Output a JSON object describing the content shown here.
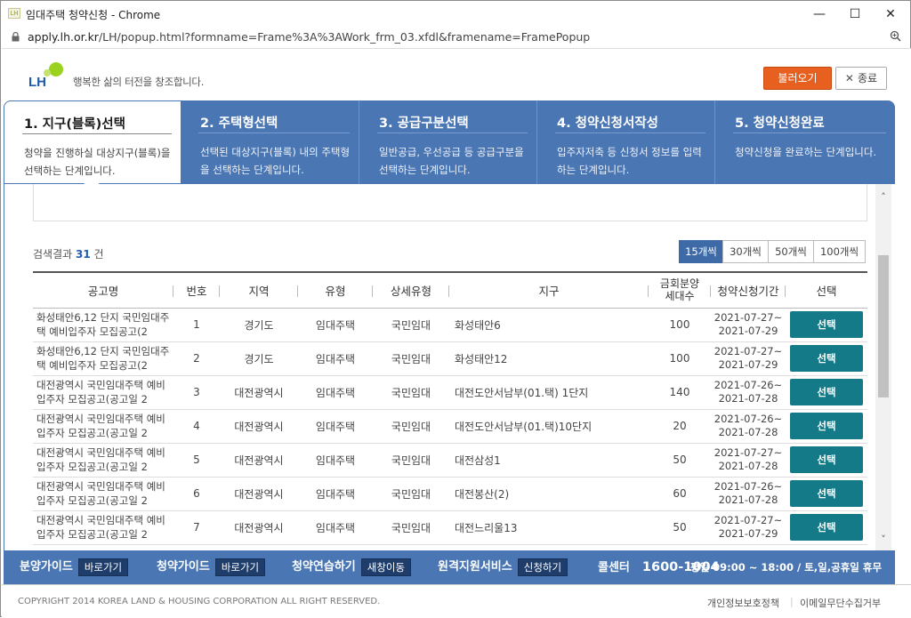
{
  "window": {
    "title": "임대주택 청약신청 - Chrome",
    "favicon": "LH",
    "minimize": "—",
    "maximize": "☐",
    "close": "✕"
  },
  "address": {
    "url_host": "apply.lh.or.kr",
    "url_path": "/LH/popup.html?formname=Frame%3A%3AWork_frm_03.xfdl&framename=FramePopup"
  },
  "header": {
    "logo_text": "LH",
    "slogan": "행복한 삶의 터전을 창조합니다.",
    "load_label": "불러오기",
    "close_label": "종료",
    "close_x": "✕"
  },
  "steps": [
    {
      "title": "1. 지구(블록)선택",
      "desc": "청약을 진행하실 대상지구(블록)을 선택하는 단계입니다."
    },
    {
      "title": "2. 주택형선택",
      "desc": "선택된 대상지구(블록) 내의 주택형을 선택하는 단계입니다."
    },
    {
      "title": "3. 공급구분선택",
      "desc": "일반공급, 우선공급 등 공급구분을 선택하는 단계입니다."
    },
    {
      "title": "4. 청약신청서작성",
      "desc": "입주자저축 등 신청서 정보를 입력하는 단계입니다."
    },
    {
      "title": "5. 청약신청완료",
      "desc": "청약신청을 완료하는 단계입니다."
    }
  ],
  "results": {
    "label": "검색결과",
    "count": "31",
    "unit": "건"
  },
  "pager": [
    "15개씩",
    "30개씩",
    "50개씩",
    "100개씩"
  ],
  "table": {
    "headers": {
      "name": "공고명",
      "no": "번호",
      "region": "지역",
      "type": "유형",
      "subtype": "상세유형",
      "district": "지구",
      "units1": "금회분양",
      "units2": "세대수",
      "period": "청약신청기간",
      "select": "선택"
    },
    "rows": [
      {
        "name": "화성태안6,12 단지 국민임대주택 예비입주자 모집공고(2",
        "no": "1",
        "region": "경기도",
        "type": "임대주택",
        "subtype": "국민임대",
        "district": "화성태안6",
        "units": "100",
        "p1": "2021-07-27~",
        "p2": "2021-07-29",
        "btn": "선택"
      },
      {
        "name": "화성태안6,12 단지 국민임대주택 예비입주자 모집공고(2",
        "no": "2",
        "region": "경기도",
        "type": "임대주택",
        "subtype": "국민임대",
        "district": "화성태안12",
        "units": "100",
        "p1": "2021-07-27~",
        "p2": "2021-07-29",
        "btn": "선택"
      },
      {
        "name": "대전광역시 국민임대주택 예비입주자 모집공고(공고일 2",
        "no": "3",
        "region": "대전광역시",
        "type": "임대주택",
        "subtype": "국민임대",
        "district": "대전도안서남부(01.택) 1단지",
        "units": "140",
        "p1": "2021-07-26~",
        "p2": "2021-07-28",
        "btn": "선택"
      },
      {
        "name": "대전광역시 국민임대주택 예비입주자 모집공고(공고일 2",
        "no": "4",
        "region": "대전광역시",
        "type": "임대주택",
        "subtype": "국민임대",
        "district": "대전도안서남부(01.택)10단지",
        "units": "20",
        "p1": "2021-07-26~",
        "p2": "2021-07-28",
        "btn": "선택"
      },
      {
        "name": "대전광역시 국민임대주택 예비입주자 모집공고(공고일 2",
        "no": "5",
        "region": "대전광역시",
        "type": "임대주택",
        "subtype": "국민임대",
        "district": "대전삼성1",
        "units": "50",
        "p1": "2021-07-27~",
        "p2": "2021-07-28",
        "btn": "선택"
      },
      {
        "name": "대전광역시 국민임대주택 예비입주자 모집공고(공고일 2",
        "no": "6",
        "region": "대전광역시",
        "type": "임대주택",
        "subtype": "국민임대",
        "district": "대전봉산(2)",
        "units": "60",
        "p1": "2021-07-26~",
        "p2": "2021-07-28",
        "btn": "선택"
      },
      {
        "name": "대전광역시 국민임대주택 예비입주자 모집공고(공고일 2",
        "no": "7",
        "region": "대전광역시",
        "type": "임대주택",
        "subtype": "국민임대",
        "district": "대전느리울13",
        "units": "50",
        "p1": "2021-07-27~",
        "p2": "2021-07-29",
        "btn": "선택"
      }
    ]
  },
  "guide": {
    "g1": "분양가이드",
    "g1b": "바로가기",
    "g2": "청약가이드",
    "g2b": "바로가기",
    "g3": "청약연습하기",
    "g3b": "새창이동",
    "g4": "원격지원서비스",
    "g4b": "신청하기",
    "call": "콜센터",
    "call_number": "1600-1004",
    "hours": "평일 09:00 ~ 18:00 / 토,일,공휴일 휴무"
  },
  "footer": {
    "copyright": "COPYRIGHT 2014 KOREA LAND & HOUSING CORPORATION ALL RIGHT RESERVED.",
    "privacy": "개인정보보호정책",
    "sep": "|",
    "email": "이메일무단수집거부"
  },
  "colors": {
    "accent": "#4a76b3",
    "select_btn": "#157a87",
    "load_btn": "#e86020"
  }
}
